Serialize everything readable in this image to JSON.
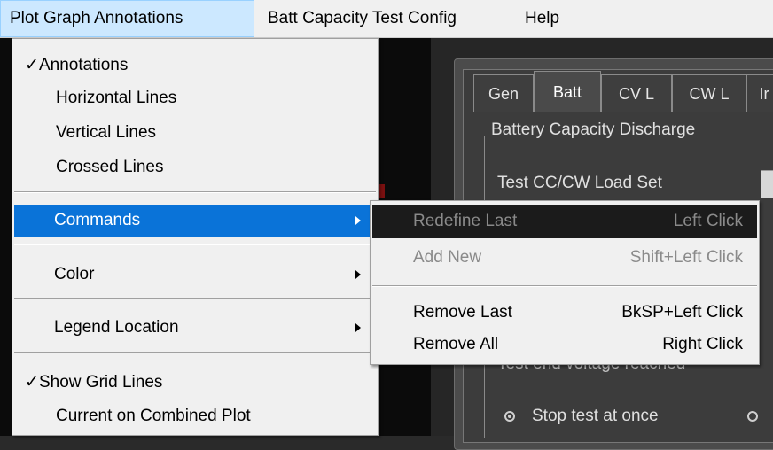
{
  "menubar": {
    "items": [
      {
        "label": "Plot Graph Annotations"
      },
      {
        "label": "Batt Capacity Test Config"
      },
      {
        "label": "Help"
      }
    ]
  },
  "dropdown": {
    "annotations": {
      "label": "Annotations",
      "checked": "✓"
    },
    "horizontal_lines": {
      "label": "Horizontal Lines"
    },
    "vertical_lines": {
      "label": "Vertical Lines"
    },
    "crossed_lines": {
      "label": "Crossed Lines"
    },
    "commands": {
      "label": "Commands"
    },
    "color": {
      "label": "Color"
    },
    "legend_location": {
      "label": "Legend Location"
    },
    "show_grid_lines": {
      "label": "Show Grid Lines",
      "checked": "✓"
    },
    "current_on_combined_plot": {
      "label": "Current on Combined Plot"
    }
  },
  "submenu": {
    "items": [
      {
        "label": "Redefine Last",
        "shortcut": "Left Click"
      },
      {
        "label": "Add New",
        "shortcut": "Shift+Left Click"
      },
      {
        "label": "Remove Last",
        "shortcut": "BkSP+Left Click"
      },
      {
        "label": "Remove All",
        "shortcut": "Right Click"
      }
    ]
  },
  "background": {
    "tabs": [
      {
        "label": "Gen"
      },
      {
        "label": "Batt"
      },
      {
        "label": "CV L"
      },
      {
        "label": "CW L"
      },
      {
        "label": "Ir"
      }
    ],
    "group_title": "Battery Capacity Discharge",
    "load_set_label": "Test CC/CW Load Set",
    "obscured_text": "Test end voltage reached ",
    "stop_test_label": "Stop test at once"
  },
  "colors": {
    "menu_highlight": "#0a73d8",
    "submenu_highlight": "#1b1b1b",
    "menubar_active": "#cce8ff"
  }
}
